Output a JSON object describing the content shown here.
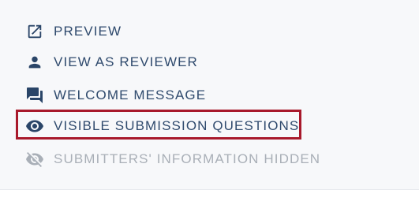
{
  "menu": {
    "items": [
      {
        "label": "PREVIEW",
        "icon": "open-in-new-icon",
        "enabled": true
      },
      {
        "label": "VIEW AS REVIEWER",
        "icon": "person-icon",
        "enabled": true
      },
      {
        "label": "WELCOME MESSAGE",
        "icon": "chat-bubble-icon",
        "enabled": true
      },
      {
        "label": "VISIBLE SUBMISSION QUESTIONS",
        "icon": "eye-icon",
        "enabled": true,
        "highlighted": true
      },
      {
        "label": "SUBMITTERS' INFORMATION HIDDEN",
        "icon": "eye-off-icon",
        "enabled": false
      }
    ]
  },
  "colors": {
    "text": "#2f4a6d",
    "icon": "#2a4568",
    "disabled": "#a9afb7",
    "highlight_border": "#a8192b",
    "panel_background": "#f7f8fa"
  }
}
